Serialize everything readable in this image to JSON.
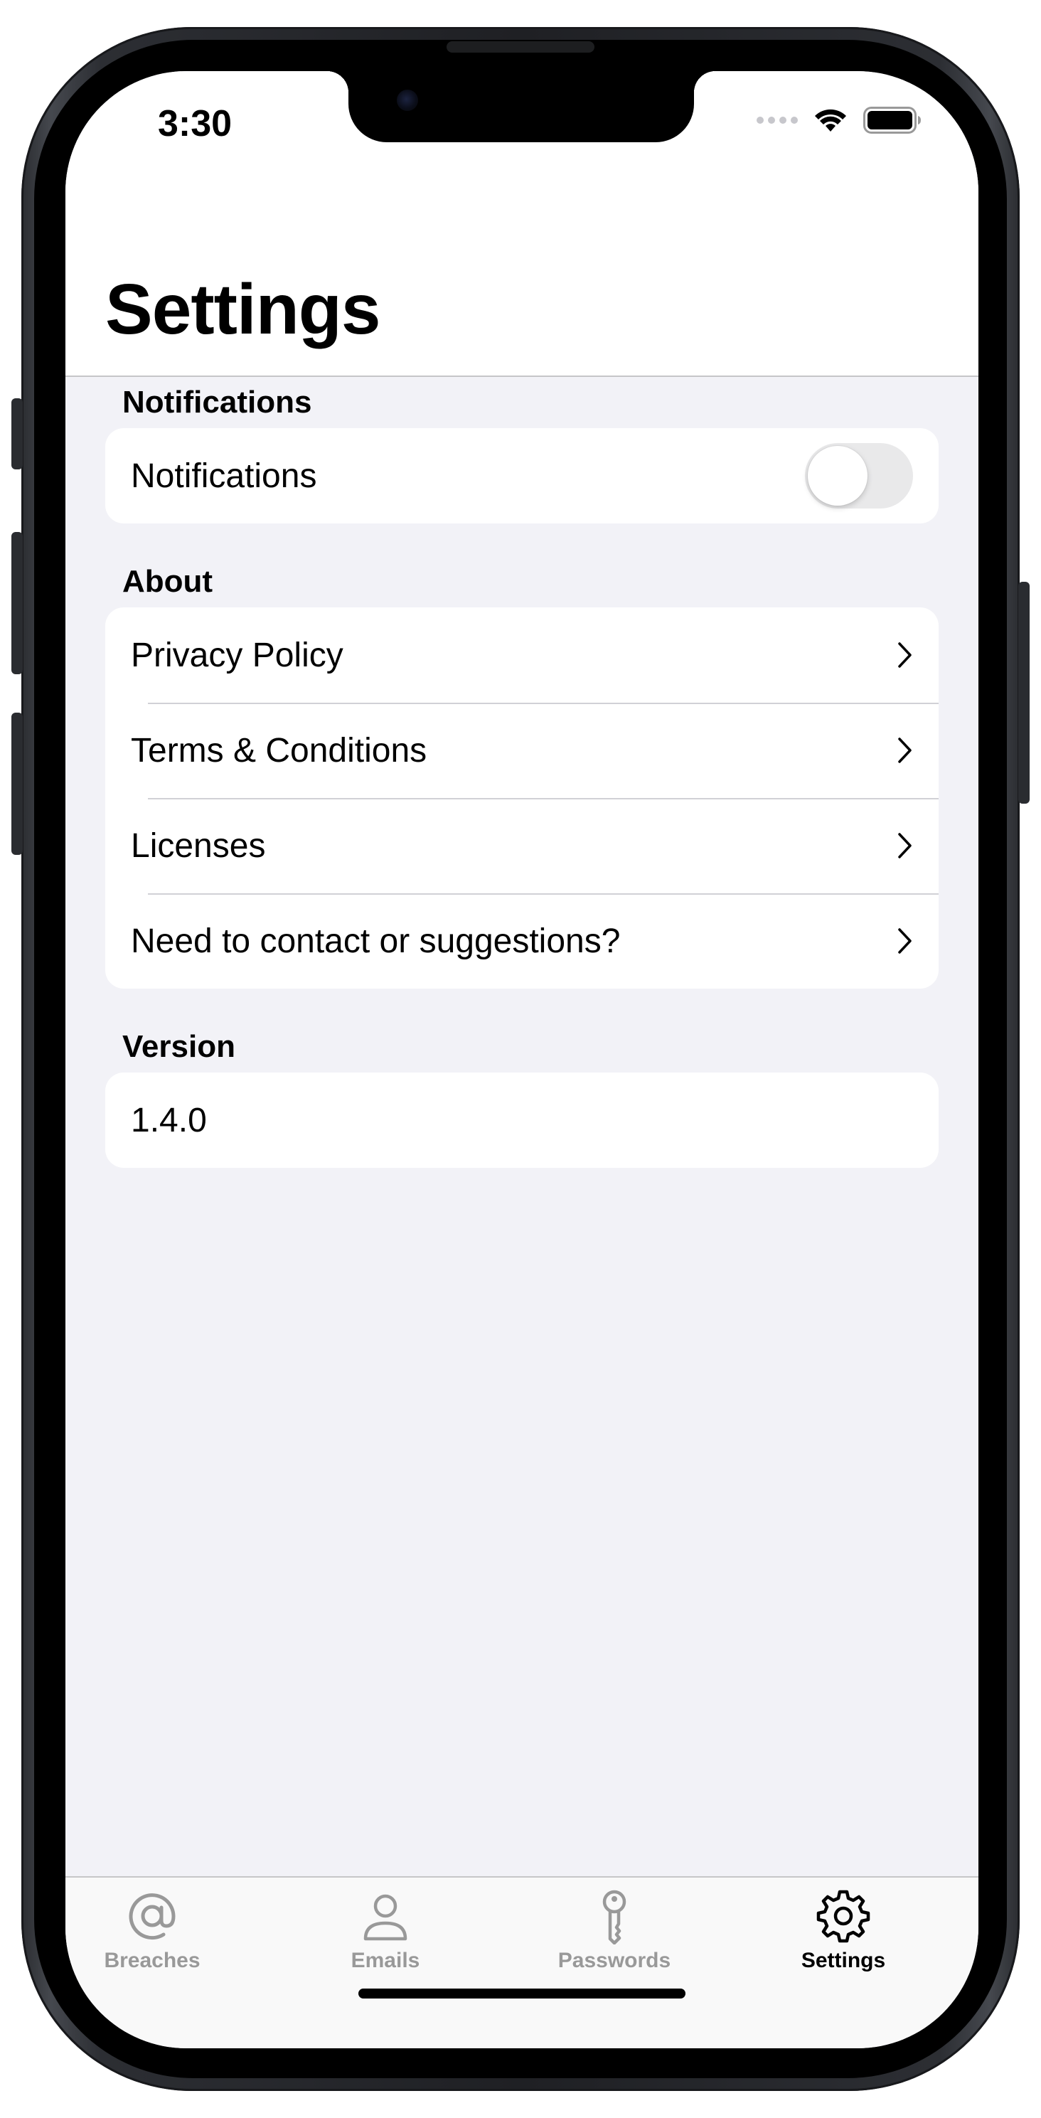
{
  "status_bar": {
    "time": "3:30"
  },
  "header": {
    "title": "Settings"
  },
  "sections": {
    "notifications": {
      "header": "Notifications",
      "toggle_label": "Notifications",
      "toggle_on": false
    },
    "about": {
      "header": "About",
      "items": [
        {
          "label": "Privacy Policy"
        },
        {
          "label": "Terms & Conditions"
        },
        {
          "label": "Licenses"
        },
        {
          "label": "Need to contact or suggestions?"
        }
      ]
    },
    "version": {
      "header": "Version",
      "value": "1.4.0"
    }
  },
  "tabbar": {
    "tabs": [
      {
        "label": "Breaches",
        "icon": "at-sign-icon",
        "active": false
      },
      {
        "label": "Emails",
        "icon": "person-icon",
        "active": false
      },
      {
        "label": "Passwords",
        "icon": "key-icon",
        "active": false
      },
      {
        "label": "Settings",
        "icon": "gear-icon",
        "active": true
      }
    ]
  },
  "colors": {
    "background": "#f2f2f7",
    "card": "#ffffff",
    "tab_inactive": "#999999",
    "tab_active": "#000000",
    "toggle_off": "#e9e9ea"
  }
}
